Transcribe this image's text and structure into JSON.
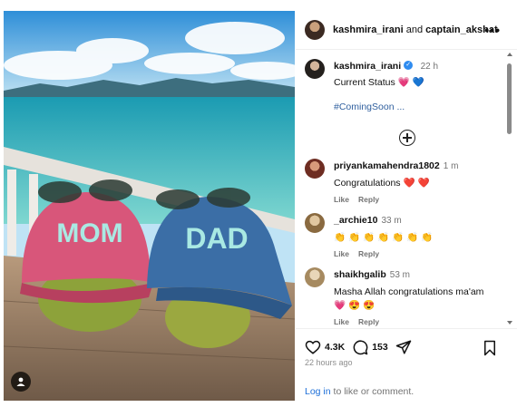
{
  "header": {
    "user1": "kashmira_irani",
    "joiner": "and",
    "user2": "captain_akshat",
    "more_label": "•••"
  },
  "caption": {
    "username": "kashmira_irani",
    "verified_mark": "✓",
    "time": "22 h",
    "text": "Current Status 💗 💙",
    "hashtag": "#ComingSoon ..."
  },
  "photo": {
    "cap_left_text": "MOM",
    "cap_right_text": "DAD"
  },
  "comments": [
    {
      "username": "priyankamahendra1802",
      "time": "1 m",
      "text": "Congratulations ❤️ ❤️",
      "like": "Like",
      "reply": "Reply"
    },
    {
      "username": "_archie10",
      "time": "33 m",
      "text": "👏 👏 👏 👏 👏 👏 👏",
      "like": "Like",
      "reply": "Reply"
    },
    {
      "username": "shaikhgalib",
      "time": "53 m",
      "text": "Masha Allah congratulations ma'am",
      "text2": "💗 😍 😍",
      "like": "Like",
      "reply": "Reply"
    }
  ],
  "footer": {
    "likes": "4.3K",
    "comments": "153",
    "posted": "22 hours ago",
    "login_link": "Log in",
    "login_text": " to like or comment."
  },
  "colors": {
    "link": "#1d6fd8",
    "hashtag": "#2f5f9e",
    "heart": "#ed4956",
    "verified": "#2f8cf0"
  }
}
